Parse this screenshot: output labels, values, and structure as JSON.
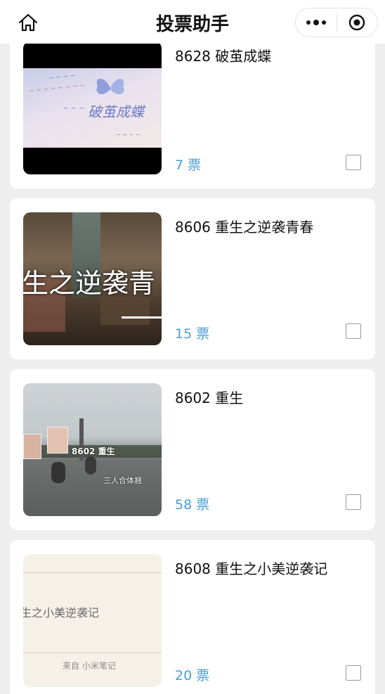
{
  "header": {
    "title": "投票助手",
    "home_icon": "home-icon",
    "more_icon": "more-dots-icon",
    "close_icon": "capsule-close-icon"
  },
  "items": [
    {
      "title": "8628 破茧成蝶",
      "votes": "7 票",
      "thumb_texts": [
        "破茧成蝶"
      ]
    },
    {
      "title": "8606 重生之逆袭青春",
      "votes": "15 票",
      "thumb_texts": [
        "生之逆袭青"
      ]
    },
    {
      "title": "8602 重生",
      "votes": "58 票",
      "thumb_texts": [
        "8602 重生",
        "三人合体翘"
      ]
    },
    {
      "title": "8608 重生之小美逆袭记",
      "votes": "20 票",
      "thumb_texts": [
        "生之小美逆袭记",
        "来自 小米笔记"
      ]
    }
  ],
  "colors": {
    "background": "#eeeeee",
    "card": "#ffffff",
    "votes": "#4a9dd6"
  }
}
